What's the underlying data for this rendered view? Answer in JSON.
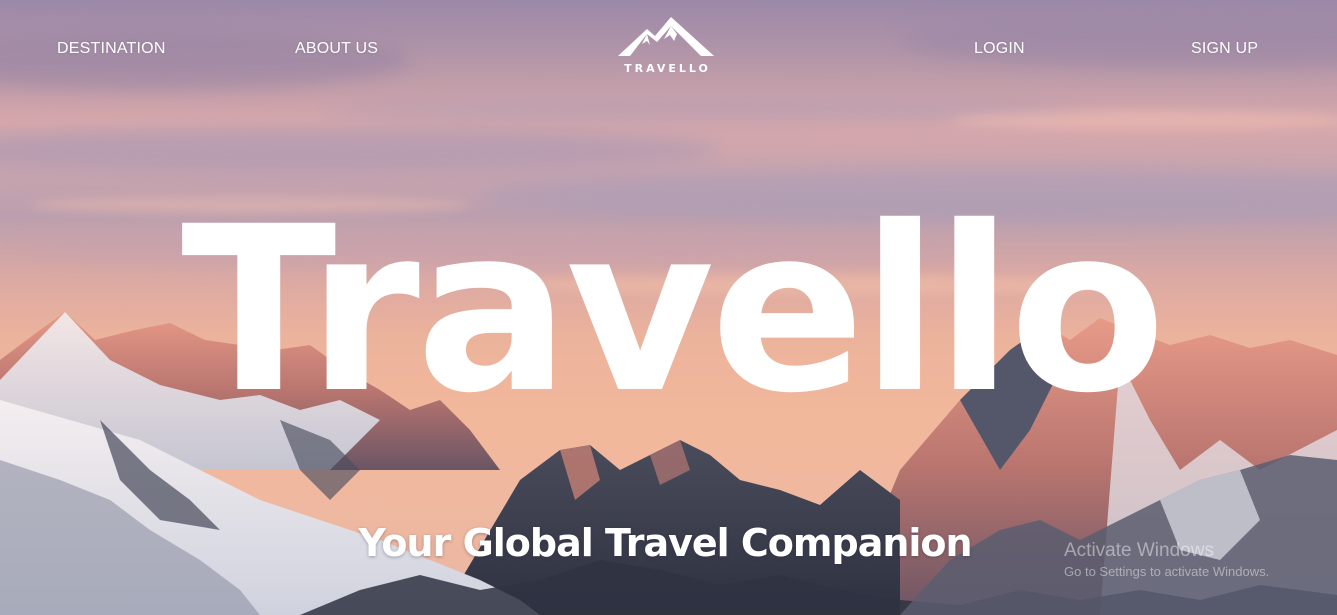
{
  "nav": {
    "destination": "DESTINATION",
    "about": "ABOUT US",
    "login": "LOGIN",
    "signup": "SIGN UP"
  },
  "logo": {
    "text": "TRAVELLO",
    "icon": "mountain-peaks-icon"
  },
  "hero": {
    "title": "Travello",
    "subtitle": "Your Global Travel Companion"
  },
  "watermark": {
    "title": "Activate Windows",
    "subtitle": "Go to Settings to activate Windows."
  },
  "colors": {
    "text": "#ffffff",
    "sky_top": "#9b88a8",
    "sky_glow": "#f2b89b",
    "snow": "#eef0f5",
    "rock_shadow": "#3c3f4e",
    "rock_lit": "#d9887a"
  }
}
